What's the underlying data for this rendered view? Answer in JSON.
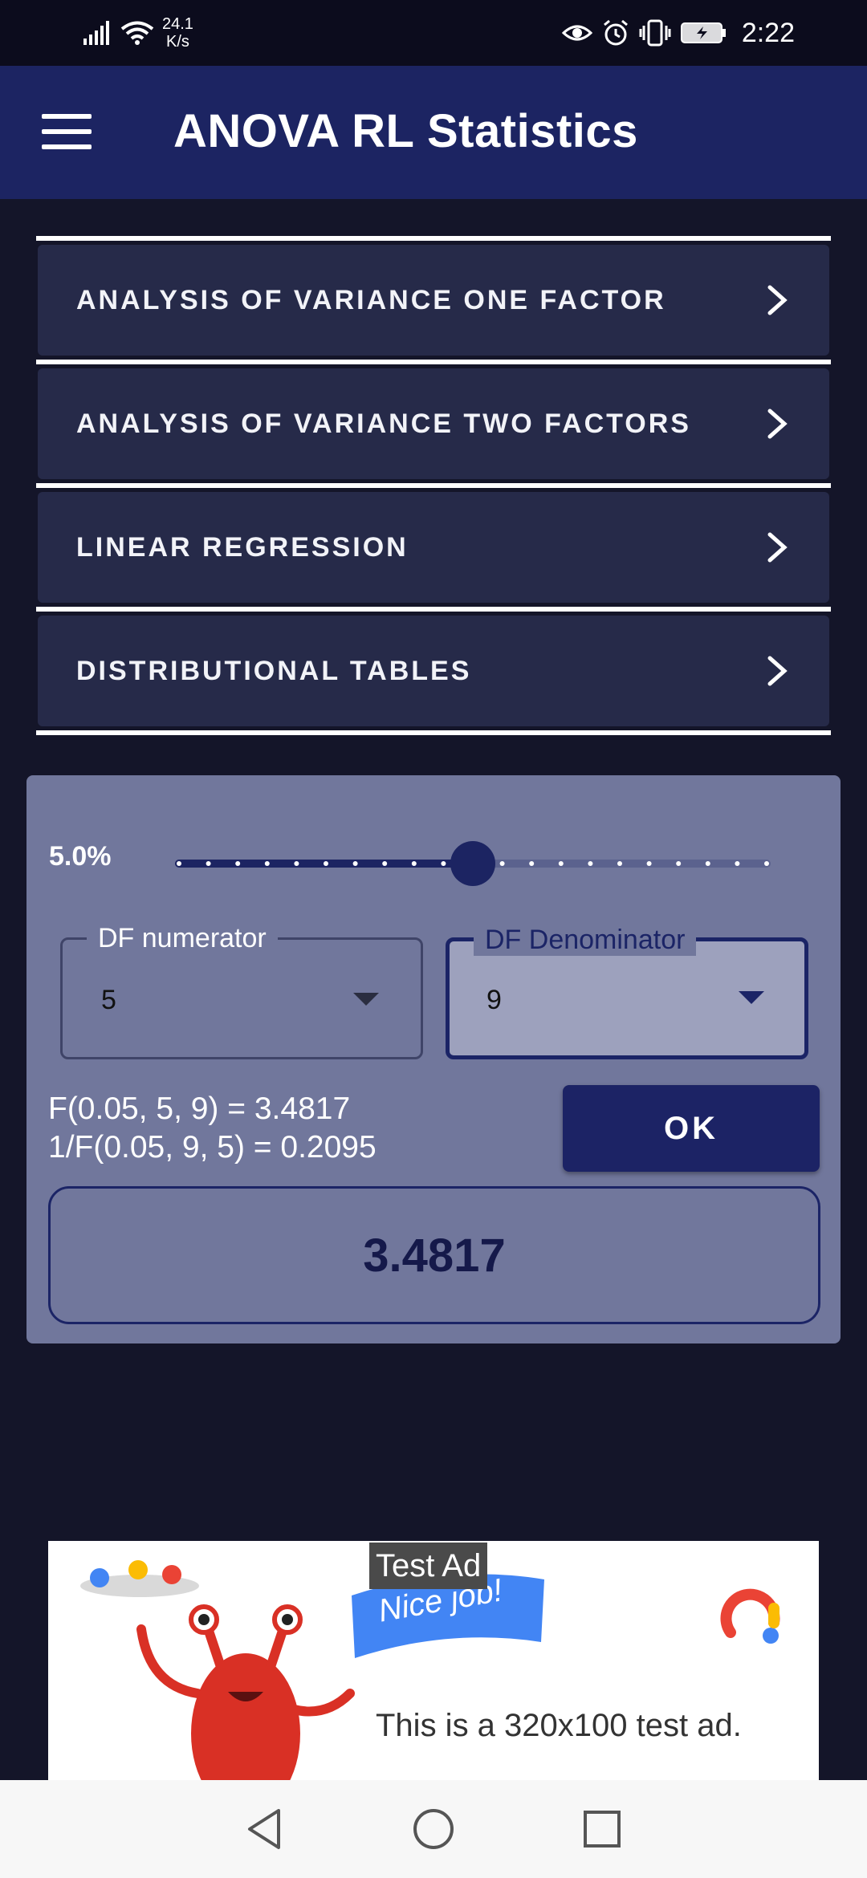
{
  "status_bar": {
    "net_speed_value": "24.1",
    "net_speed_unit": "K/s",
    "time": "2:22",
    "icons": [
      "signal-icon",
      "wifi-icon",
      "eye-icon",
      "alarm-icon",
      "vibrate-icon",
      "battery-charging-icon"
    ]
  },
  "app_bar": {
    "title": "ANOVA RL Statistics",
    "menu_icon": "hamburger-icon"
  },
  "menu": {
    "items": [
      {
        "label": "ANALYSIS OF VARIANCE ONE FACTOR"
      },
      {
        "label": "ANALYSIS OF VARIANCE TWO FACTORS"
      },
      {
        "label": "LINEAR REGRESSION"
      },
      {
        "label": "DISTRIBUTIONAL TABLES"
      }
    ]
  },
  "f_table": {
    "alpha_label": "5.0%",
    "slider": {
      "value_fraction": 0.5,
      "step_count": 20
    },
    "df_numerator": {
      "label": "DF numerator",
      "value": "5"
    },
    "df_denominator": {
      "label": "DF Denominator",
      "value": "9"
    },
    "result_line_1": "F(0.05, 5, 9) = 3.4817",
    "result_line_2": "1/F(0.05, 9, 5) = 0.2095",
    "ok_label": "OK",
    "result_value": "3.4817"
  },
  "ad": {
    "tag": "Test Ad",
    "banner": "Nice job!",
    "text": "This is a 320x100 test ad."
  },
  "nav_bar": {
    "icons": [
      "back-icon",
      "home-icon",
      "recents-icon"
    ]
  },
  "colors": {
    "background": "#141529",
    "app_bar": "#1c2462",
    "menu_item": "#262a49",
    "card": "#71779c",
    "accent": "#1b2466"
  }
}
